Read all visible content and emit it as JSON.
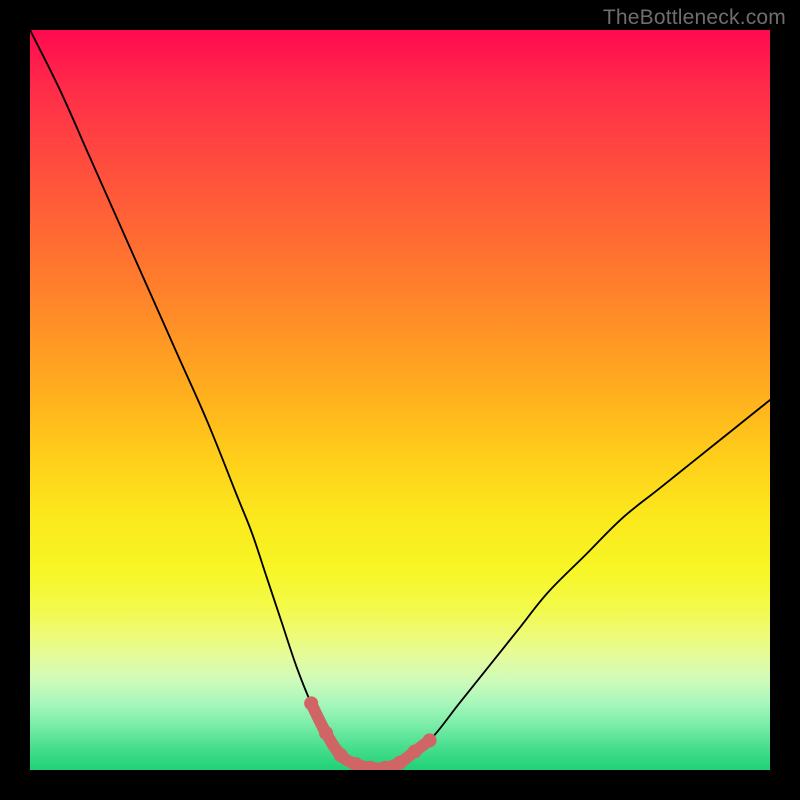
{
  "watermark": "TheBottleneck.com",
  "chart_data": {
    "type": "line",
    "title": "",
    "xlabel": "",
    "ylabel": "",
    "xlim": [
      0,
      100
    ],
    "ylim": [
      0,
      100
    ],
    "grid": false,
    "series": [
      {
        "name": "curve",
        "x": [
          0,
          4,
          8,
          12,
          16,
          20,
          24,
          28,
          30,
          32,
          34,
          36,
          38,
          40,
          42,
          44,
          46,
          48,
          50,
          54,
          58,
          62,
          66,
          70,
          75,
          80,
          85,
          90,
          95,
          100
        ],
        "y": [
          100,
          92,
          83,
          74,
          65,
          56,
          47,
          37,
          32,
          26,
          20,
          14,
          9,
          5,
          2,
          1,
          0,
          0,
          1,
          4,
          9,
          14,
          19,
          24,
          29,
          34,
          38,
          42,
          46,
          50
        ]
      },
      {
        "name": "highlight",
        "x": [
          38,
          40,
          42,
          44,
          46,
          48,
          50,
          52,
          54
        ],
        "y": [
          9,
          5,
          2,
          0.8,
          0.3,
          0.3,
          1,
          2.5,
          4
        ]
      }
    ],
    "annotations": []
  }
}
